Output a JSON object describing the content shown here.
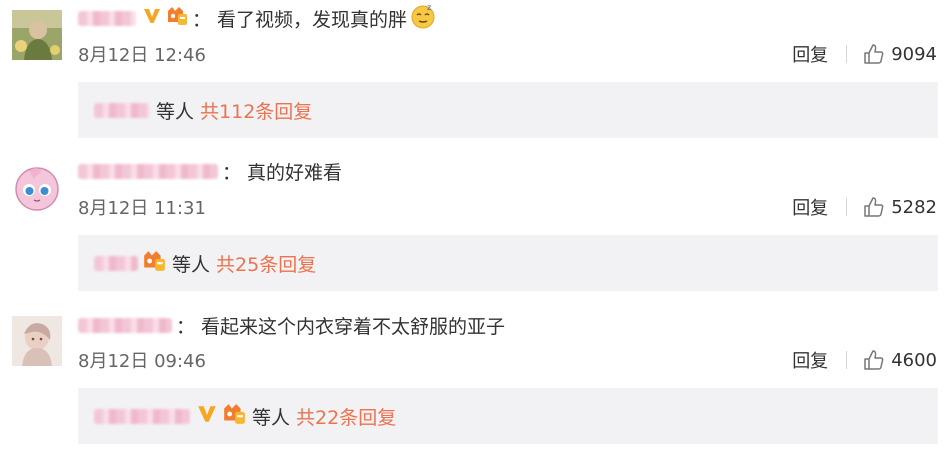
{
  "comments": [
    {
      "text": "看了视频，发现真的胖",
      "colon": "：",
      "time": "8月12日 12:46",
      "reply_label": "回复",
      "likes": "9094",
      "thread": {
        "deng": "等人",
        "count": "共112条回复"
      }
    },
    {
      "text": "真的好难看",
      "colon": "：",
      "time": "8月12日 11:31",
      "reply_label": "回复",
      "likes": "5282",
      "thread": {
        "deng": "等人",
        "count": "共25条回复"
      }
    },
    {
      "text": "看起来这个内衣穿着不太舒服的亚子",
      "colon": "：",
      "time": "8月12日 09:46",
      "reply_label": "回复",
      "likes": "4600",
      "thread": {
        "deng": "等人",
        "count": "共22条回复"
      }
    }
  ],
  "colors": {
    "reply_count": "#eb7350",
    "reply_box_bg": "#f2f2f5",
    "meta_text": "#666666",
    "v_badge": "#f5a623",
    "level_badge": "#f27d2e"
  },
  "icons": [
    "v-verified-icon",
    "vip-level-icon",
    "emoji-icon",
    "like-thumb-icon"
  ]
}
